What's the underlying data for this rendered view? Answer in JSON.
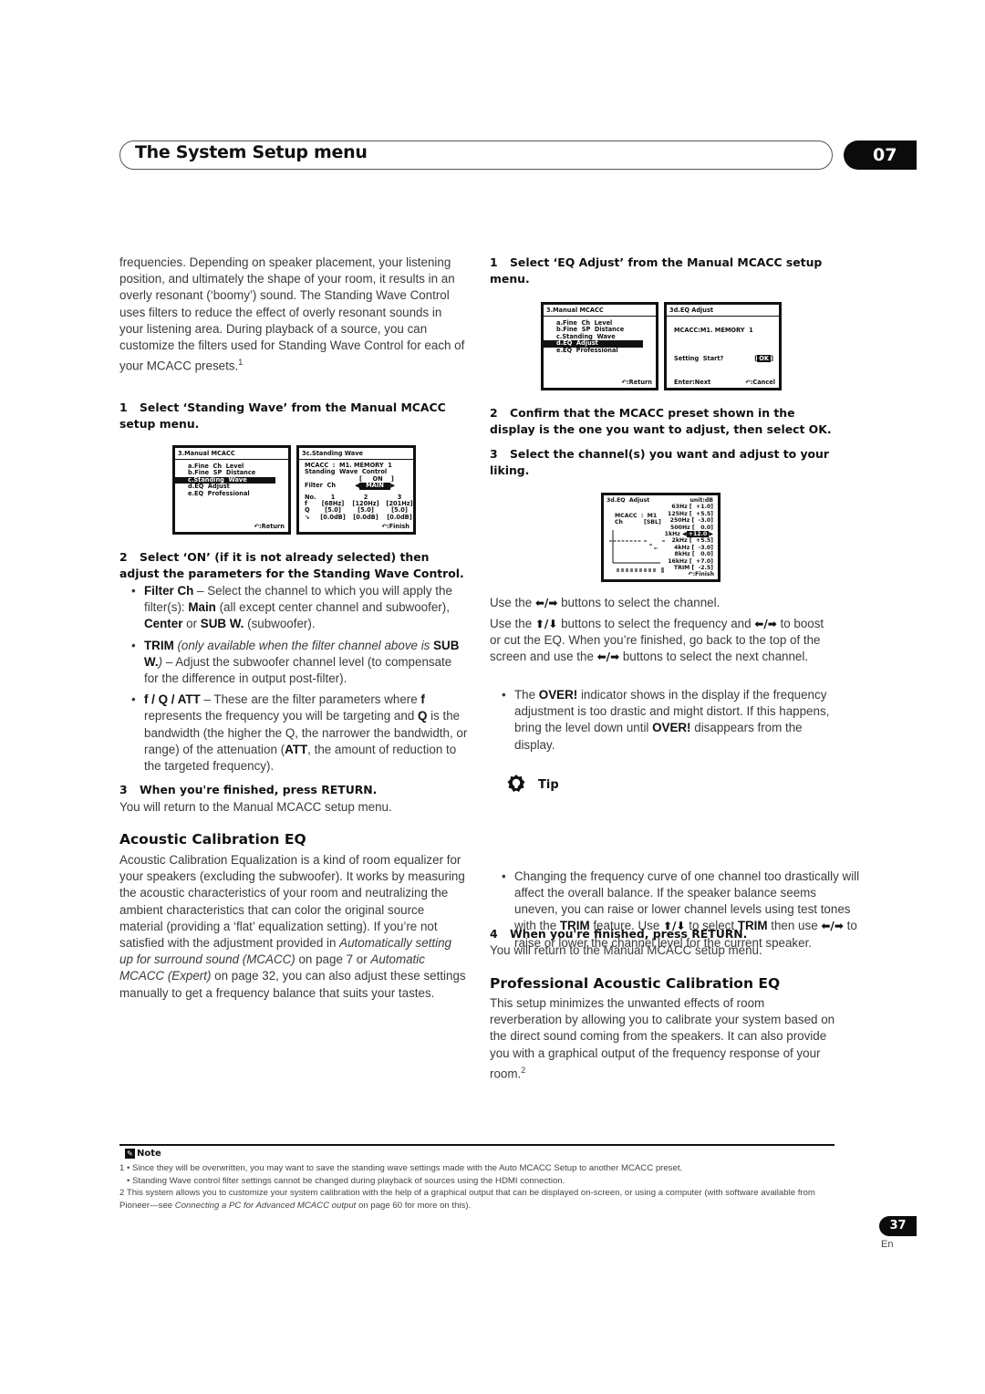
{
  "header": {
    "title": "The System Setup menu",
    "chapter": "07"
  },
  "left": {
    "intro": "frequencies. Depending on speaker placement, your listening position, and ultimately the shape of your room, it results in an overly resonant (‘boomy’) sound. The Standing Wave Control uses filters to reduce the effect of overly resonant sounds in your listening area. During playback of a source, you can customize the filters used for Standing Wave Control for each of your MCACC presets.",
    "intro_footnote": "1",
    "step1": {
      "num": "1",
      "text": "Select ‘Standing Wave’ from the Manual MCACC setup menu."
    },
    "step2": {
      "num": "2",
      "text": "Select ‘ON’ (if it is not already selected) then adjust the parameters for the Standing Wave Control."
    },
    "bullets": [
      {
        "bold": "Filter Ch",
        "text1": " – Select the channel to which you will apply the filter(s): ",
        "b2": "Main",
        "text2": " (all except center channel and subwoofer), ",
        "b3": "Center",
        "text3": " or ",
        "b4": "SUB W.",
        "text4": " (subwoofer)."
      },
      {
        "bold": "TRIM",
        "italic": " (only available when the filter channel above is ",
        "b2": "SUB W.",
        "italic2": ")",
        "text": " – Adjust the subwoofer channel level (to compensate for the difference in output post-filter)."
      },
      {
        "bold": "f / Q / ATT",
        "text1": " – These are the filter parameters where ",
        "b2": "f",
        "text2": " represents the frequency you will be targeting and ",
        "b3": "Q",
        "text3": " is the bandwidth (the higher the Q, the narrower the bandwidth, or range) of the attenuation (",
        "b4": "ATT",
        "text4": ", the amount of reduction to the targeted frequency)."
      }
    ],
    "step3": {
      "num": "3",
      "text": "When you're finished, press RETURN."
    },
    "step3_body": "You will return to the Manual MCACC setup menu.",
    "section_title": "Acoustic Calibration EQ",
    "section_body_1": "Acoustic Calibration Equalization is a kind of room equalizer for your speakers (excluding the subwoofer). It works by measuring the acoustic characteristics of your room and neutralizing the ambient characteristics that can color the original source material (providing a ‘flat’ equalization setting). If you’re not satisfied with the adjustment provided in ",
    "section_link_1": "Automatically setting up for surround sound (MCACC)",
    "section_body_2": " on page 7 or ",
    "section_link_2": "Automatic MCACC (Expert)",
    "section_body_3": " on page 32, you can also adjust these settings manually to get a frequency balance that suits your tastes."
  },
  "osd_manual_menu": {
    "title": "3.Manual  MCACC",
    "items": [
      "a.Fine  Ch  Level",
      "b.Fine  SP  Distance",
      "c.Standing  Wave",
      "d.EQ  Adjust",
      "e.EQ  Professional"
    ],
    "return": ":Return"
  },
  "osd_standing_wave": {
    "title": "3c.Standing  Wave",
    "mcacc": "MCACC  :  M1. MEMORY  1",
    "control": "Standing  Wave  Control",
    "control_value": "[     ON    ]",
    "filter_label": "Filter  Ch",
    "filter_value": "MAIN",
    "header_row": [
      "No.",
      "1",
      "2",
      "3"
    ],
    "f_row": [
      "f",
      "68Hz",
      "120Hz",
      "201Hz"
    ],
    "q_row": [
      "Q",
      "5.0",
      "5.0",
      "5.0"
    ],
    "att_row": [
      "ATT",
      "0.0dB",
      "0.0dB",
      "0.0dB"
    ],
    "finish": ":Finish"
  },
  "right": {
    "step1": {
      "num": "1",
      "text": "Select ‘EQ Adjust’ from the Manual MCACC setup menu."
    },
    "step2": {
      "num": "2",
      "text": "Confirm that the MCACC preset shown in the display is the one you want to adjust, then select OK."
    },
    "step3": {
      "num": "3",
      "text": "Select the channel(s) you want and adjust to your liking."
    },
    "para1_a": "Use the ",
    "para1_b": " buttons to select the channel.",
    "para2_a": "Use the ",
    "para2_b": " buttons to select the frequency and ",
    "para2_c": " to boost or cut the EQ. When you’re finished, go back to the top of the screen and use the ",
    "para2_d": " buttons to select the next channel.",
    "over_bullet_a": "The ",
    "over_bold": "OVER!",
    "over_bullet_b": " indicator shows in the display if the frequency adjustment is too drastic and might distort. If this happens, bring the level down until ",
    "over_bullet_c": " disappears from the display.",
    "tip_title": "Tip",
    "tip_a": "Changing the frequency curve of one channel too drastically will affect the overall balance. If the speaker balance seems uneven, you can raise or lower channel levels using test tones with the ",
    "tip_trim": "TRIM",
    "tip_b": " feature. Use ",
    "tip_c": " to select ",
    "tip_d": " then use ",
    "tip_e": " to raise or lower the channel level for the current speaker.",
    "step4": {
      "num": "4",
      "text": "When you're finished, press RETURN."
    },
    "step4_body": "You will return to the Manual MCACC setup menu.",
    "section_title": "Professional Acoustic Calibration EQ",
    "section_body": "This setup minimizes the unwanted effects of room reverberation by allowing you to calibrate your system based on the direct sound coming from the speakers. It can also provide you with a graphical output of the frequency response of your room.",
    "section_footnote": "2",
    "arrows": {
      "leftright": "⬅/➡",
      "updown": "⬆/⬇"
    }
  },
  "osd_eq_start": {
    "title": "3d.EQ  Adjust",
    "mcacc": "MCACC:M1. MEMORY  1",
    "prompt": "Setting  Start?",
    "ok": "OK",
    "next": "Enter:Next",
    "cancel": ":Cancel"
  },
  "osd_eq_adjust": {
    "title": "3d.EQ  Adjust",
    "unit": "unit:dB",
    "mcacc_label": "MCACC  :  M1",
    "ch_label": "Ch",
    "ch_value": "[SBL]",
    "bands": [
      {
        "freq": "63Hz",
        "value": "+1.0"
      },
      {
        "freq": "125Hz",
        "value": "+5.5"
      },
      {
        "freq": "250Hz",
        "value": "-3.0"
      },
      {
        "freq": "500Hz",
        "value": "0.0"
      },
      {
        "freq": "1kHz",
        "value": "+12.0",
        "selected": true
      },
      {
        "freq": "2kHz",
        "value": "+5.5"
      },
      {
        "freq": "4kHz",
        "value": "-3.0"
      },
      {
        "freq": "8kHz",
        "value": "0.0"
      },
      {
        "freq": "16kHz",
        "value": "+7.0"
      },
      {
        "freq": "TRIM",
        "value": "-2.5"
      }
    ],
    "finish": ":Finish"
  },
  "notes": {
    "title": "Note",
    "n1_num": "1",
    "n1_a": "Since they will be overwritten, you may want to save the standing wave settings made with the Auto MCACC Setup to another MCACC preset.",
    "n1_b": "Standing Wave control filter settings cannot be changed during playback of sources using the HDMI connection.",
    "n2_num": "2",
    "n2_a": "This system allows you to customize your system calibration with the help of a graphical output that can be displayed on-screen, or using a computer (with software available from Pioneer—see ",
    "n2_link": "Connecting a PC for Advanced MCACC output",
    "n2_b": " on page 60 for more on this)."
  },
  "footer": {
    "page": "37",
    "lang": "En"
  }
}
